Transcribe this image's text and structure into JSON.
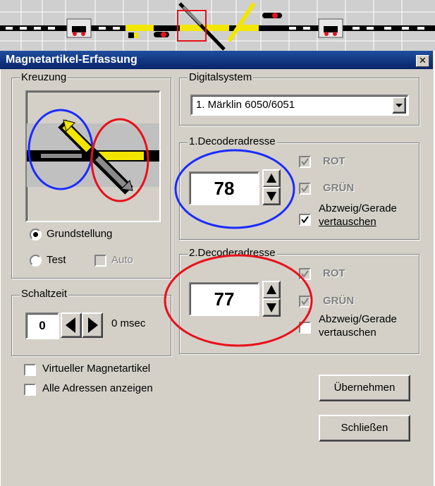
{
  "dialog": {
    "title": "Magnetartikel-Erfassung",
    "close_glyph": "✕"
  },
  "kreuzung": {
    "label": "Kreuzung",
    "grundstellung": "Grundstellung",
    "grundstellung_selected": true,
    "test": "Test",
    "auto": "Auto"
  },
  "schaltzeit": {
    "label": "Schaltzeit",
    "value": "0",
    "unit": "0 msec"
  },
  "digitalsystem": {
    "label": "Digitalsystem",
    "selected": "1. Märklin 6050/6051"
  },
  "decoder1": {
    "label": "1.Decoderadresse",
    "address": "78",
    "rot": "ROT",
    "gruen": "GRÜN",
    "swap_line1": "Abzweig/Gerade",
    "swap_line2": "vertauschen",
    "swap_checked": true
  },
  "decoder2": {
    "label": "2.Decoderadresse",
    "address": "77",
    "rot": "ROT",
    "gruen": "GRÜN",
    "swap_line1": "Abzweig/Gerade",
    "swap_line2": "vertauschen",
    "swap_checked": false
  },
  "options": {
    "virtual": "Virtueller Magnetartikel",
    "all_addresses": "Alle Adressen anzeigen"
  },
  "buttons": {
    "apply": "Übernehmen",
    "close": "Schließen"
  },
  "colors": {
    "annotation_blue": "#1a2cff",
    "annotation_red": "#e8101a",
    "track_yellow": "#f2e600"
  }
}
